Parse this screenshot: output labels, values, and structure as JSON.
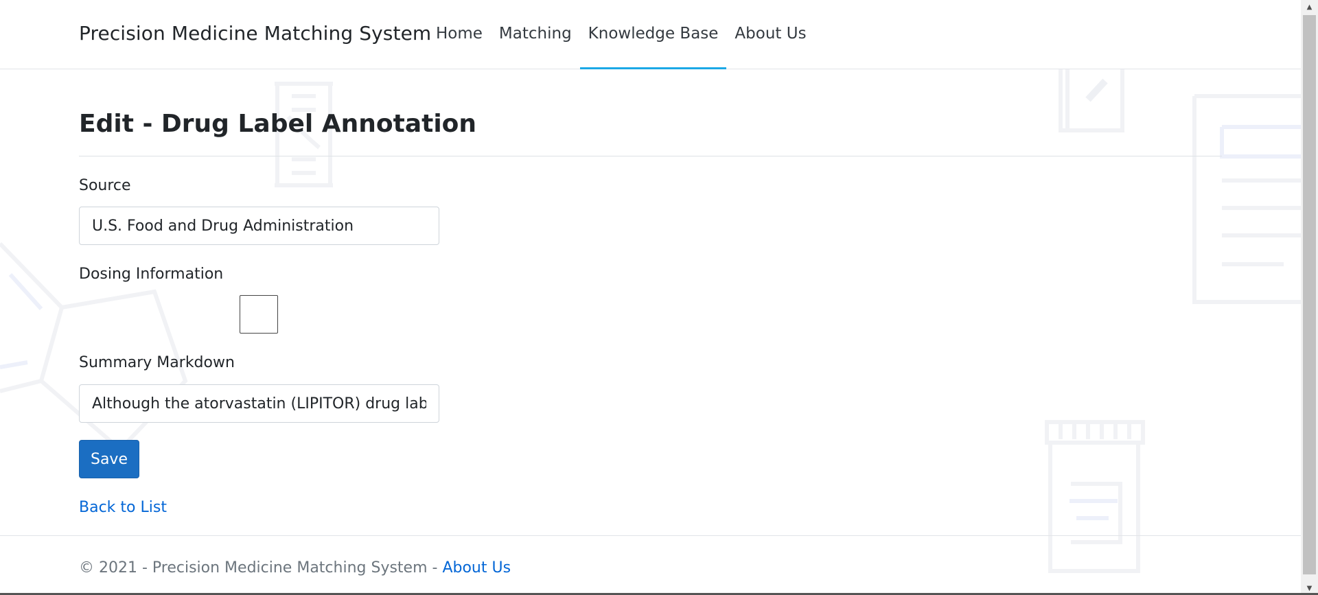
{
  "navbar": {
    "brand": "Precision Medicine Matching System",
    "links": [
      {
        "label": "Home",
        "active": false
      },
      {
        "label": "Matching",
        "active": false
      },
      {
        "label": "Knowledge Base",
        "active": true
      },
      {
        "label": "About Us",
        "active": false
      }
    ],
    "active_color": "#1ba8e6"
  },
  "main": {
    "title": "Edit - Drug Label Annotation",
    "fields": {
      "source": {
        "label": "Source",
        "value": "U.S. Food and Drug Administration"
      },
      "dosing": {
        "label": "Dosing Information",
        "checked": false
      },
      "summary": {
        "label": "Summary Markdown",
        "value": "Although the atorvastatin (LIPITOR) drug label"
      }
    },
    "save_label": "Save",
    "back_link": "Back to List"
  },
  "footer": {
    "text": "© 2021 - Precision Medicine Matching System - ",
    "link": "About Us"
  },
  "colors": {
    "primary_button": "#1b6ec2",
    "link": "#0366d6"
  },
  "icons": {
    "scroll_up": "▲",
    "scroll_down": "▼"
  }
}
